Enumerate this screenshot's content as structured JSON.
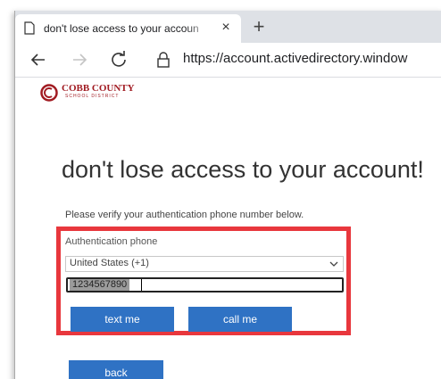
{
  "browser": {
    "tab_title": "don't lose access to your accoun",
    "close_glyph": "×",
    "new_tab_glyph": "+",
    "url": "https://account.activedirectory.window"
  },
  "logo": {
    "name": "COBB COUNTY",
    "subtitle": "SCHOOL DISTRICT",
    "color": "#a11b22"
  },
  "page": {
    "title": "don't lose access to your account!",
    "instructions": "Please verify your authentication phone number below.",
    "field_label": "Authentication phone",
    "country_select": "United States (+1)",
    "phone_value": "1234567890",
    "text_me_label": "text me",
    "call_me_label": "call me",
    "back_label": "back"
  },
  "colors": {
    "button": "#2f72c4",
    "highlight": "#e8373d"
  },
  "icons": {
    "tab": "page-icon",
    "close": "close-icon",
    "back": "arrow-left-icon",
    "forward": "arrow-right-icon",
    "refresh": "refresh-icon",
    "lock": "lock-icon",
    "dropdown": "chevron-down-icon"
  }
}
